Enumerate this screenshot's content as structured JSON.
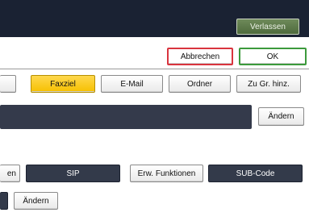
{
  "header": {
    "exit_label": "Verlassen"
  },
  "dialog_actions": {
    "cancel_label": "Abbrechen",
    "ok_label": "OK"
  },
  "dest_tabs": [
    {
      "label": "Faxziel"
    },
    {
      "label": "E-Mail"
    },
    {
      "label": "Ordner"
    },
    {
      "label": "Zu Gr. hinz."
    }
  ],
  "destination": {
    "change_label": "Ändern"
  },
  "options": {
    "partial_left_label": "en",
    "sip_label": "SIP",
    "extended_label": "Erw. Funktionen",
    "sub_code_label": "SUB-Code"
  },
  "bottom": {
    "change_label": "Ändern"
  },
  "colors": {
    "header_bg": "#1a2233",
    "active_tab": "#f6c000",
    "cancel_border": "#d9343e",
    "ok_border": "#3c9a3c",
    "dark_button": "#333a4a"
  }
}
